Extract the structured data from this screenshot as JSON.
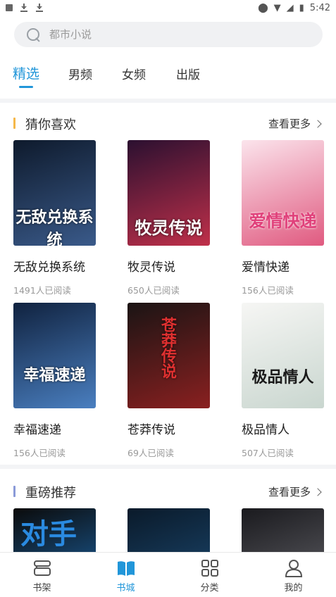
{
  "status_bar": {
    "time": "5:42"
  },
  "search": {
    "placeholder": "都市小说"
  },
  "tabs": [
    {
      "label": "精选",
      "active": true
    },
    {
      "label": "男频",
      "active": false
    },
    {
      "label": "女频",
      "active": false
    },
    {
      "label": "出版",
      "active": false
    }
  ],
  "sections": [
    {
      "title": "猜你喜欢",
      "more_label": "查看更多",
      "bar_color": "#f5b84a",
      "books": [
        {
          "title": "无敌兑换系统",
          "readers": "1491人已阅读",
          "cover_text": "无敌兑换系统",
          "cover_colors": [
            "#0e1a2c",
            "#3a5a8a"
          ]
        },
        {
          "title": "牧灵传说",
          "readers": "650人已阅读",
          "cover_text": "牧灵传说",
          "cover_colors": [
            "#2b1030",
            "#c0304a"
          ]
        },
        {
          "title": "爱情快递",
          "readers": "156人已阅读",
          "cover_text": "爱情快递",
          "cover_colors": [
            "#fbe4ec",
            "#e05a80"
          ]
        },
        {
          "title": "幸福速递",
          "readers": "156人已阅读",
          "cover_text": "幸福速递",
          "cover_colors": [
            "#10223f",
            "#4a7fc0"
          ]
        },
        {
          "title": "苍莽传说",
          "readers": "69人已阅读",
          "cover_text": "苍莽传说",
          "cover_colors": [
            "#1a1414",
            "#8a2020"
          ]
        },
        {
          "title": "极品情人",
          "readers": "507人已阅读",
          "cover_text": "极品情人",
          "cover_colors": [
            "#f6f6f4",
            "#c9d6cf"
          ]
        }
      ]
    },
    {
      "title": "重磅推荐",
      "more_label": "查看更多",
      "bar_color": "#8a9ad8",
      "books": [
        {
          "cover_text": "对手",
          "cover_colors": [
            "#0b0b0b",
            "#1e6fb8"
          ]
        },
        {
          "cover_text": "",
          "cover_colors": [
            "#0a1a2a",
            "#1e4f7a"
          ]
        },
        {
          "cover_text": "",
          "cover_colors": [
            "#1a1a1e",
            "#6a6a70"
          ]
        }
      ]
    }
  ],
  "bottom_nav": [
    {
      "label": "书架",
      "icon": "bookshelf-icon",
      "active": false
    },
    {
      "label": "书城",
      "icon": "bookstore-icon",
      "active": true
    },
    {
      "label": "分类",
      "icon": "category-grid-icon",
      "active": false
    },
    {
      "label": "我的",
      "icon": "profile-icon",
      "active": false
    }
  ],
  "colors": {
    "accent": "#2196d9",
    "divider": "#f3f4f6"
  }
}
